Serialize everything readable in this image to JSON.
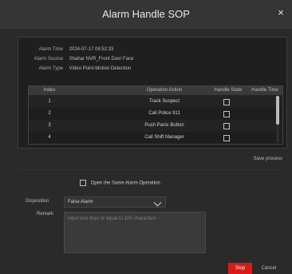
{
  "dialog": {
    "title": "Alarm Handle SOP",
    "close_icon": "×"
  },
  "alarm": {
    "time_label": "Alarm Time",
    "time_value": "2024-07-17 08:52:33",
    "source_label": "Alarm Source",
    "source_value": "Shahar NVR_Front Door Face",
    "type_label": "Alarm Type",
    "type_value": "Video Point-Motion Detection"
  },
  "table": {
    "headers": [
      "Index",
      "Operation Action",
      "Handle State",
      "Handle Time"
    ],
    "rows": [
      {
        "index": "1",
        "action": "Track Suspect",
        "state": false,
        "time": ""
      },
      {
        "index": "2",
        "action": "Call Police 911",
        "state": false,
        "time": ""
      },
      {
        "index": "3",
        "action": "Push Panic Button",
        "state": false,
        "time": ""
      },
      {
        "index": "4",
        "action": "Call Shift Manager",
        "state": false,
        "time": ""
      }
    ]
  },
  "actions": {
    "save_process": "Save process"
  },
  "lower": {
    "open_same": "Open the Same Alarm Operation",
    "disposition_label": "Disposition",
    "disposition_value": "False Alarm",
    "remark_label": "Remark",
    "remark_placeholder": "Input less than or equal to 100 characters"
  },
  "buttons": {
    "stop": "Stop",
    "cancel": "Cancel"
  },
  "colors": {
    "stop_button": "#e01616",
    "dialog_bg": "#2a2a2a"
  }
}
